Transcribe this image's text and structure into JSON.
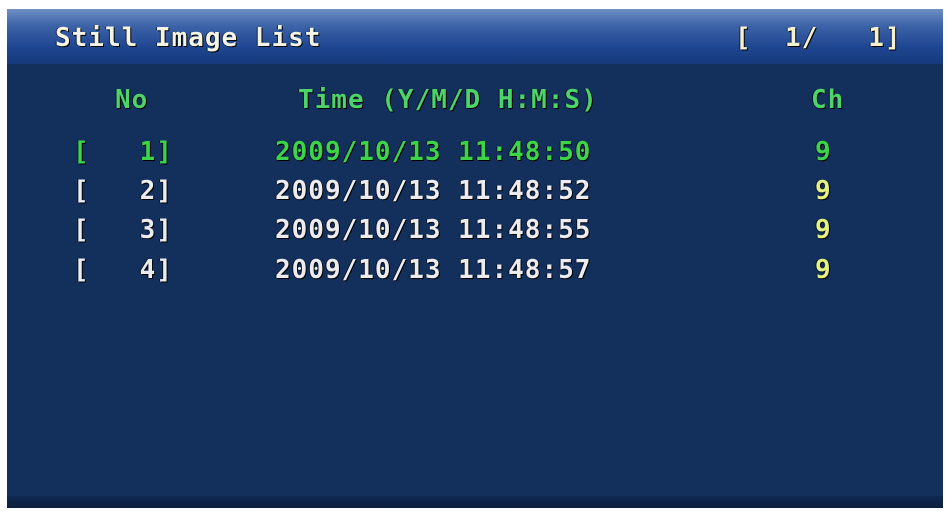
{
  "header": {
    "title": "Still Image List",
    "page_indicator": "[  1/   1]"
  },
  "columns": {
    "no": "No",
    "time": "Time (Y/M/D H:M:S)",
    "ch": "Ch"
  },
  "rows": [
    {
      "no": "[   1]",
      "time": "2009/10/13 11:48:50",
      "ch": "9",
      "selected": true
    },
    {
      "no": "[   2]",
      "time": "2009/10/13 11:48:52",
      "ch": "9",
      "selected": false
    },
    {
      "no": "[   3]",
      "time": "2009/10/13 11:48:55",
      "ch": "9",
      "selected": false
    },
    {
      "no": "[   4]",
      "time": "2009/10/13 11:48:57",
      "ch": "9",
      "selected": false
    }
  ],
  "colors": {
    "background": "#13305c",
    "titlebar": "#2a4f96",
    "header_text": "#4ed36a",
    "selected_text": "#3ed44a",
    "normal_text": "#ececf0"
  }
}
